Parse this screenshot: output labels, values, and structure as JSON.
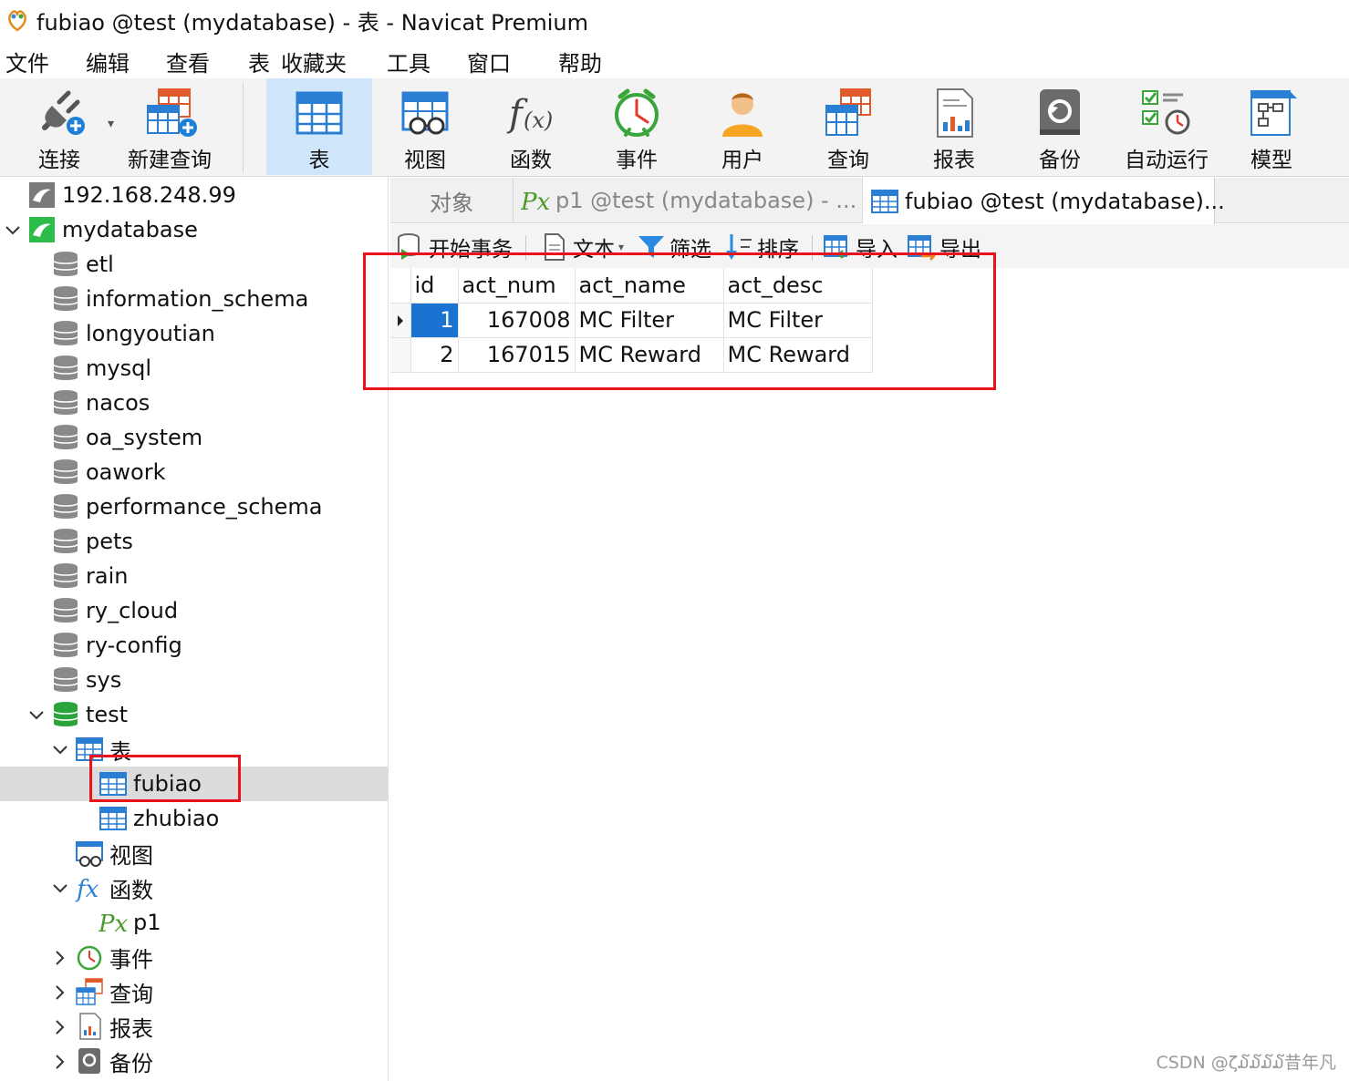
{
  "window": {
    "title": "fubiao @test (mydatabase) - 表 - Navicat Premium",
    "logo_icon": "navicat-logo-icon"
  },
  "menu": [
    "文件",
    "编辑",
    "查看",
    "表",
    "收藏夹",
    "工具",
    "窗口",
    "帮助"
  ],
  "toolbar": {
    "buttons": [
      {
        "label": "连接",
        "icon": "plug-connect-icon"
      },
      {
        "label": "新建查询",
        "icon": "new-query-icon"
      },
      {
        "label": "表",
        "icon": "table-icon",
        "active": true
      },
      {
        "label": "视图",
        "icon": "view-icon"
      },
      {
        "label": "函数",
        "icon": "function-icon"
      },
      {
        "label": "事件",
        "icon": "event-clock-icon"
      },
      {
        "label": "用户",
        "icon": "user-icon"
      },
      {
        "label": "查询",
        "icon": "query-icon"
      },
      {
        "label": "报表",
        "icon": "report-icon"
      },
      {
        "label": "备份",
        "icon": "backup-icon"
      },
      {
        "label": "自动运行",
        "icon": "automation-icon"
      },
      {
        "label": "模型",
        "icon": "model-icon"
      }
    ]
  },
  "navigator": {
    "connection": "192.168.248.99",
    "open_connection": "mydatabase",
    "databases": [
      "etl",
      "information_schema",
      "longyoutian",
      "mysql",
      "nacos",
      "oa_system",
      "oawork",
      "performance_schema",
      "pets",
      "rain",
      "ry_cloud",
      "ry-config",
      "sys"
    ],
    "open_database": "test",
    "tables_group": "表",
    "tables": [
      "fubiao",
      "zhubiao"
    ],
    "views_group": "视图",
    "functions_group": "函数",
    "functions": [
      "p1"
    ],
    "events_group": "事件",
    "queries_group": "查询",
    "reports_group": "报表",
    "backups_group": "备份",
    "selected_table": "fubiao"
  },
  "tabs": {
    "objects": "对象",
    "p1": "p1 @test (mydatabase) - ...",
    "fubiao": "fubiao @test (mydatabase)..."
  },
  "subtoolbar": {
    "begin_transaction": "开始事务",
    "text": "文本",
    "filter": "筛选",
    "sort": "排序",
    "import": "导入",
    "export": "导出"
  },
  "table": {
    "columns": [
      "id",
      "act_num",
      "act_name",
      "act_desc"
    ],
    "rows": [
      [
        "1",
        "167008",
        "MC Filter",
        "MC Filter"
      ],
      [
        "2",
        "167015",
        "MC Reward",
        "MC Reward"
      ]
    ],
    "selected_row": 0
  },
  "watermark": "CSDN @ζ໓໓໓໓昔年凡",
  "colors": {
    "selection": "#1a73d1",
    "highlight_box": "#e8141b",
    "active_tool": "#cfe6fb"
  }
}
